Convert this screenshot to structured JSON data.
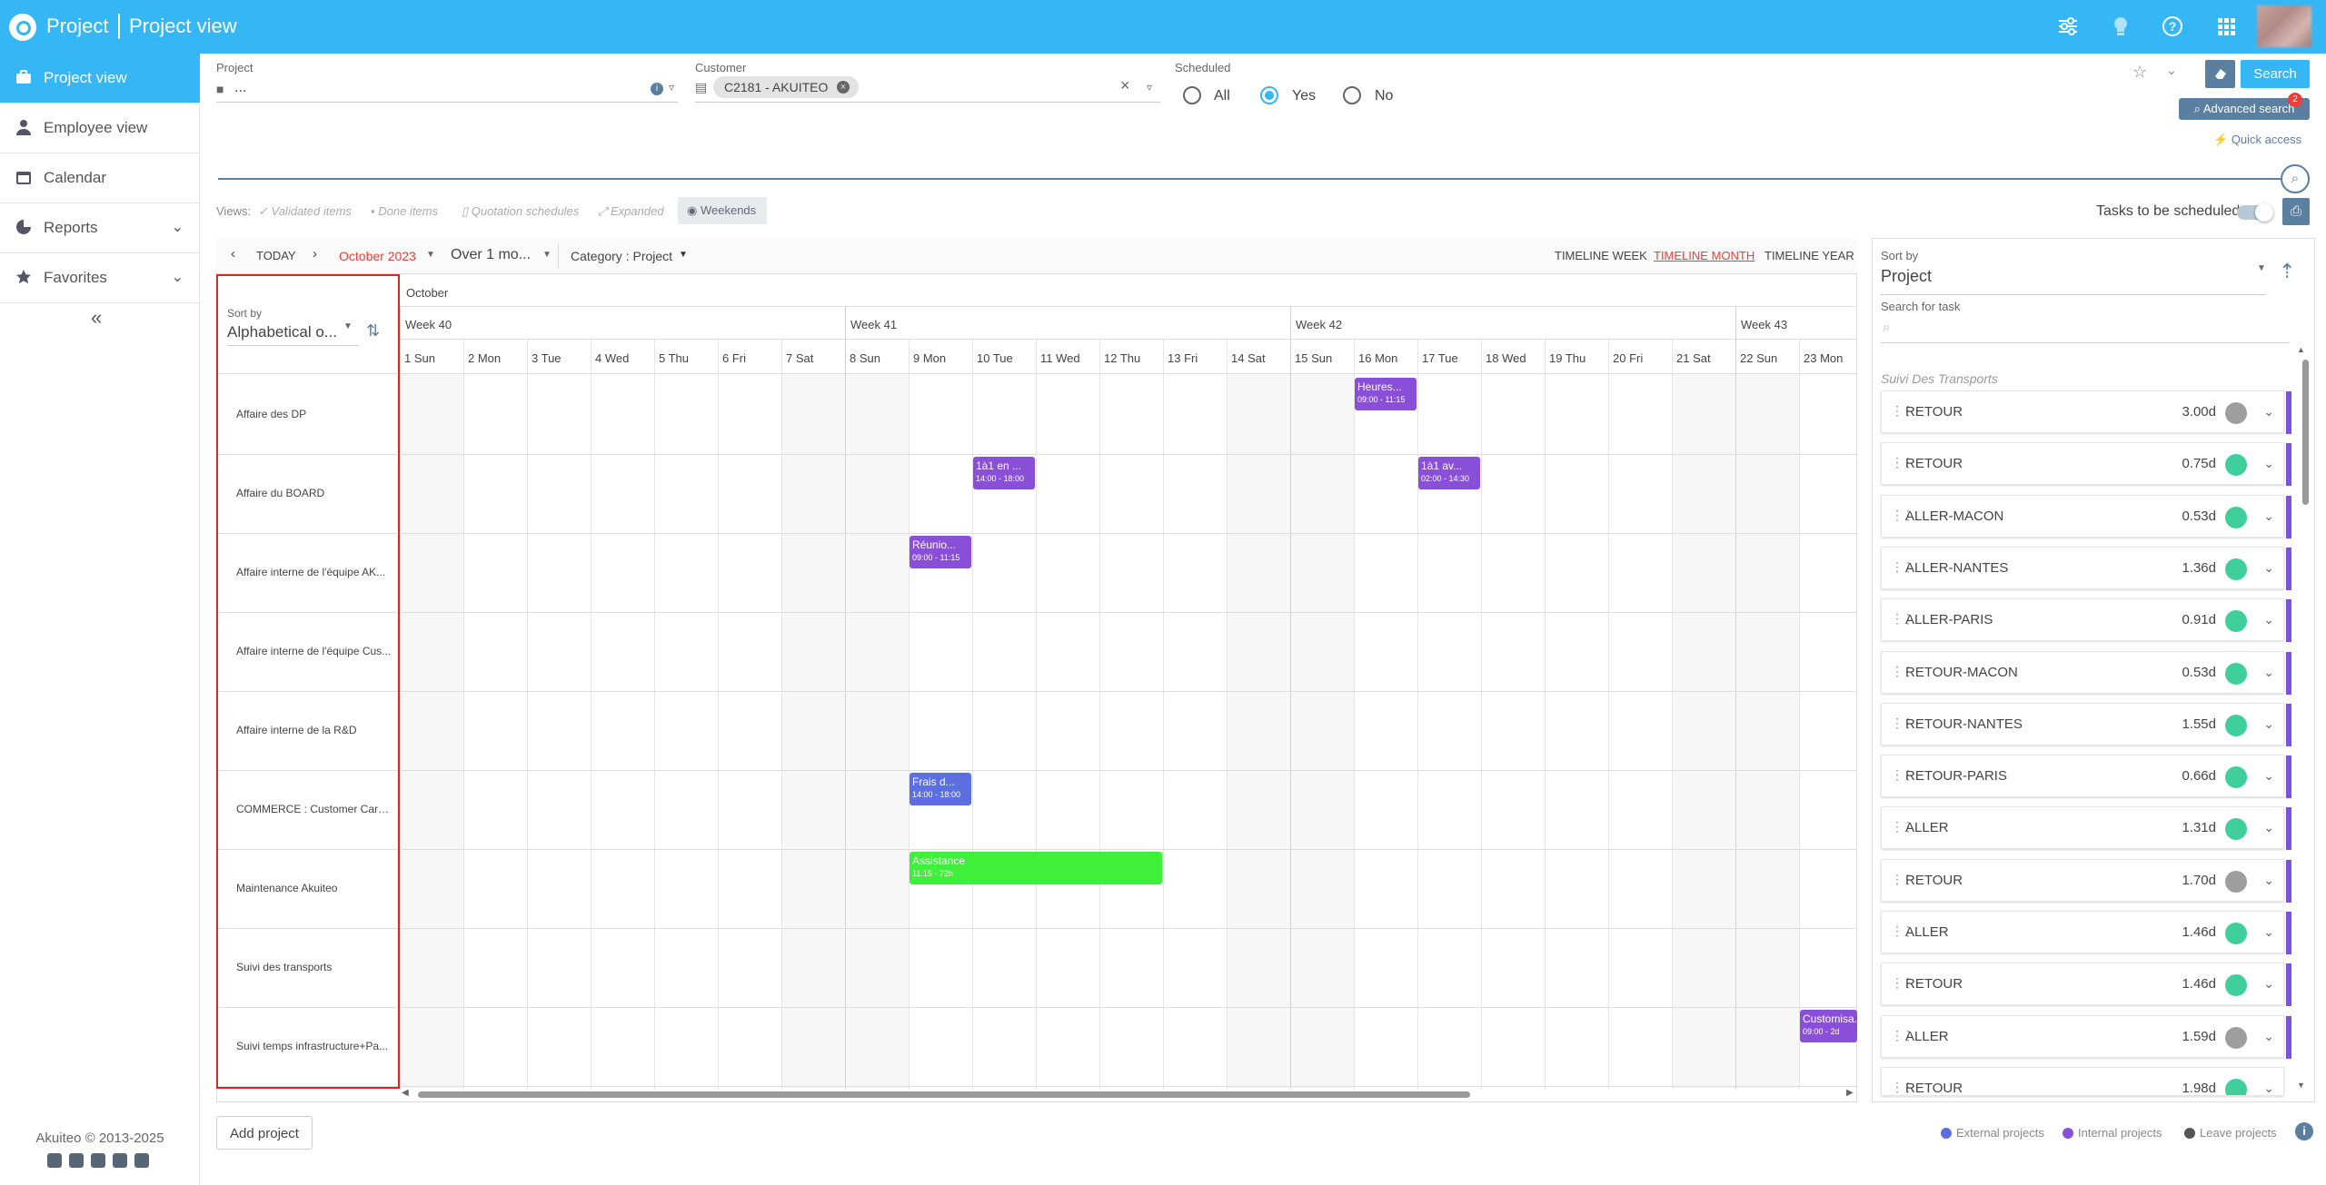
{
  "header": {
    "app_title": "Project",
    "page_title": "Project view"
  },
  "sidebar": {
    "items": [
      {
        "label": "Project view",
        "icon": "briefcase-icon"
      },
      {
        "label": "Employee view",
        "icon": "user-icon"
      },
      {
        "label": "Calendar",
        "icon": "calendar-icon"
      },
      {
        "label": "Reports",
        "icon": "chart-icon"
      },
      {
        "label": "Favorites",
        "icon": "star-icon"
      }
    ],
    "copyright": "Akuiteo © 2013-2025"
  },
  "filters": {
    "project_label": "Project",
    "project_value": "...",
    "customer_label": "Customer",
    "customer_chip": "C2181 - AKUITEO",
    "scheduled_label": "Scheduled",
    "scheduled_options": [
      "All",
      "Yes",
      "No"
    ],
    "scheduled_selected": "Yes",
    "search_label": "Search",
    "advanced_search_label": "Advanced search",
    "advanced_search_badge": "2",
    "quick_access_label": "Quick access"
  },
  "views": {
    "label": "Views:",
    "options": [
      "Validated items",
      "Done items",
      "Quotation schedules",
      "Expanded",
      "Weekends"
    ],
    "tasks_to_schedule_label": "Tasks to be scheduled"
  },
  "toolbar": {
    "today": "TODAY",
    "month": "October 2023",
    "period": "Over 1 mo...",
    "category": "Category : Project",
    "timeline_week": "TIMELINE WEEK",
    "timeline_month": "TIMELINE MONTH",
    "timeline_year": "TIMELINE YEAR"
  },
  "grid": {
    "sort_label": "Sort by",
    "sort_value": "Alphabetical o...",
    "month_label": "October",
    "weeks": [
      "Week 40",
      "Week 41",
      "Week 42",
      "Week 43"
    ],
    "days": [
      "1 Sun",
      "2 Mon",
      "3 Tue",
      "4 Wed",
      "5 Thu",
      "6 Fri",
      "7 Sat",
      "8 Sun",
      "9 Mon",
      "10 Tue",
      "11 Wed",
      "12 Thu",
      "13 Fri",
      "14 Sat",
      "15 Sun",
      "16 Mon",
      "17 Tue",
      "18 Wed",
      "19 Thu",
      "20 Fri",
      "21 Sat",
      "22 Sun",
      "23 Mon"
    ],
    "rows": [
      "Affaire des DP",
      "Affaire du BOARD",
      "Affaire interne de l'équipe AK...",
      "Affaire interne de l'équipe Cus...",
      "Affaire interne de la R&D",
      "COMMERCE : Customer Care /...",
      "Maintenance Akuiteo",
      "Suivi des transports",
      "Suivi temps infrastructure+Pa..."
    ],
    "events": [
      {
        "row": 0,
        "day": 15,
        "span": 1,
        "title": "Heures...",
        "time": "09:00 - 11:15",
        "color": "#8a4fd8"
      },
      {
        "row": 1,
        "day": 9,
        "span": 1,
        "title": "1à1 en ...",
        "time": "14:00 - 18:00",
        "color": "#8a4fd8"
      },
      {
        "row": 1,
        "day": 16,
        "span": 1,
        "title": "1à1 av...",
        "time": "02:00 - 14:30",
        "color": "#8a4fd8"
      },
      {
        "row": 2,
        "day": 8,
        "span": 1,
        "title": "Réunio...",
        "time": "09:00 - 11:15",
        "color": "#8a4fd8"
      },
      {
        "row": 5,
        "day": 8,
        "span": 1,
        "title": "Frais d...",
        "time": "14:00 - 18:00",
        "color": "#5b6fe0"
      },
      {
        "row": 6,
        "day": 8,
        "span": 4,
        "title": "Assistance",
        "time": "11:15 - 72h",
        "color": "#3ef03a"
      },
      {
        "row": 8,
        "day": 22,
        "span": 1,
        "title": "Customisa...",
        "time": "09:00 - 2d",
        "color": "#8a4fd8"
      }
    ],
    "add_project": "Add project"
  },
  "tasks_panel": {
    "sort_label": "Sort by",
    "sort_value": "Project",
    "search_label": "Search for task",
    "group": "Suivi Des Transports",
    "tasks": [
      {
        "name": "RETOUR",
        "duration": "3.00d",
        "status_color": "#9e9e9e"
      },
      {
        "name": "RETOUR",
        "duration": "0.75d",
        "status_color": "#3fcf9d"
      },
      {
        "name": "ALLER-MACON",
        "duration": "0.53d",
        "status_color": "#3fcf9d"
      },
      {
        "name": "ALLER-NANTES",
        "duration": "1.36d",
        "status_color": "#3fcf9d"
      },
      {
        "name": "ALLER-PARIS",
        "duration": "0.91d",
        "status_color": "#3fcf9d"
      },
      {
        "name": "RETOUR-MACON",
        "duration": "0.53d",
        "status_color": "#3fcf9d"
      },
      {
        "name": "RETOUR-NANTES",
        "duration": "1.55d",
        "status_color": "#3fcf9d"
      },
      {
        "name": "RETOUR-PARIS",
        "duration": "0.66d",
        "status_color": "#3fcf9d"
      },
      {
        "name": "ALLER",
        "duration": "1.31d",
        "status_color": "#3fcf9d"
      },
      {
        "name": "RETOUR",
        "duration": "1.70d",
        "status_color": "#9e9e9e"
      },
      {
        "name": "ALLER",
        "duration": "1.46d",
        "status_color": "#3fcf9d"
      },
      {
        "name": "RETOUR",
        "duration": "1.46d",
        "status_color": "#3fcf9d"
      },
      {
        "name": "ALLER",
        "duration": "1.59d",
        "status_color": "#9e9e9e"
      },
      {
        "name": "RETOUR",
        "duration": "1.98d",
        "status_color": "#3fcf9d"
      }
    ]
  },
  "legend": {
    "items": [
      {
        "label": "External projects",
        "color": "#5b6fe0"
      },
      {
        "label": "Internal projects",
        "color": "#8a4fd8"
      },
      {
        "label": "Leave projects",
        "color": "#555555"
      }
    ]
  },
  "colors": {
    "brand": "#36b7f5",
    "accent_dark": "#5a7fa0",
    "highlight": "#e02424"
  }
}
